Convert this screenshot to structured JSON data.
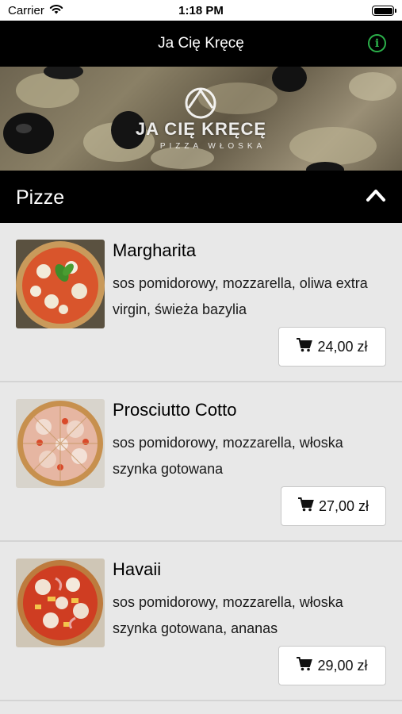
{
  "status_bar": {
    "carrier": "Carrier",
    "time": "1:18 PM"
  },
  "nav": {
    "title": "Ja Cię Kręcę",
    "info_icon": "info-icon",
    "accent_color": "#2bb14a"
  },
  "banner": {
    "logo_text": "JA CIĘ KRĘCĘ",
    "logo_subtext": "PIZZA WŁOSKA"
  },
  "section": {
    "title": "Pizze",
    "toggle_icon": "chevron-up-icon"
  },
  "items": [
    {
      "name": "Margharita",
      "description": " sos pomidorowy, mozzarella, oliwa extra virgin, świeża bazylia",
      "price": "24,00 zł"
    },
    {
      "name": "Prosciutto Cotto",
      "description": " sos pomidorowy, mozzarella, włoska szynka gotowana",
      "price": "27,00 zł"
    },
    {
      "name": "Havaii",
      "description": " sos pomidorowy, mozzarella, włoska szynka gotowana, ananas",
      "price": "29,00 zł"
    }
  ]
}
